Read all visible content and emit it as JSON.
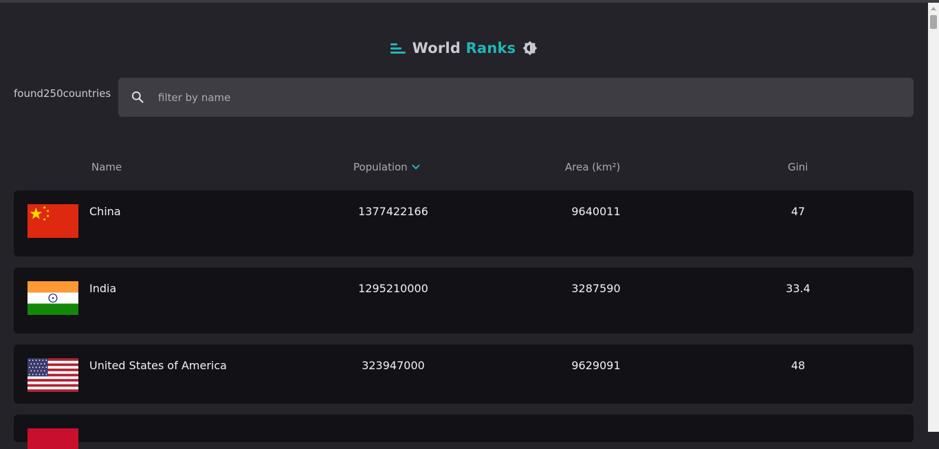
{
  "header": {
    "title_main": "World",
    "title_accent": "Ranks",
    "theme_icon": "brightness-icon",
    "logo_icon": "bar-chart-logo-icon"
  },
  "search": {
    "count_text": "found250countries",
    "placeholder": "filter by name",
    "value": ""
  },
  "columns": {
    "name": "Name",
    "population": "Population",
    "area": "Area (km²)",
    "gini": "Gini",
    "sort_icon": "chevron-down-icon"
  },
  "rows": [
    {
      "name": "China",
      "population": "1377422166",
      "area": "9640011",
      "gini": "47",
      "flag": "china-flag"
    },
    {
      "name": "India",
      "population": "1295210000",
      "area": "3287590",
      "gini": "33.4",
      "flag": "india-flag"
    },
    {
      "name": "United States of America",
      "population": "323947000",
      "area": "9629091",
      "gini": "48",
      "flag": "usa-flag"
    }
  ],
  "colors": {
    "accent": "#21b6b7",
    "background": "#242329",
    "row_background": "#121115",
    "search_background": "#3e3d44"
  }
}
